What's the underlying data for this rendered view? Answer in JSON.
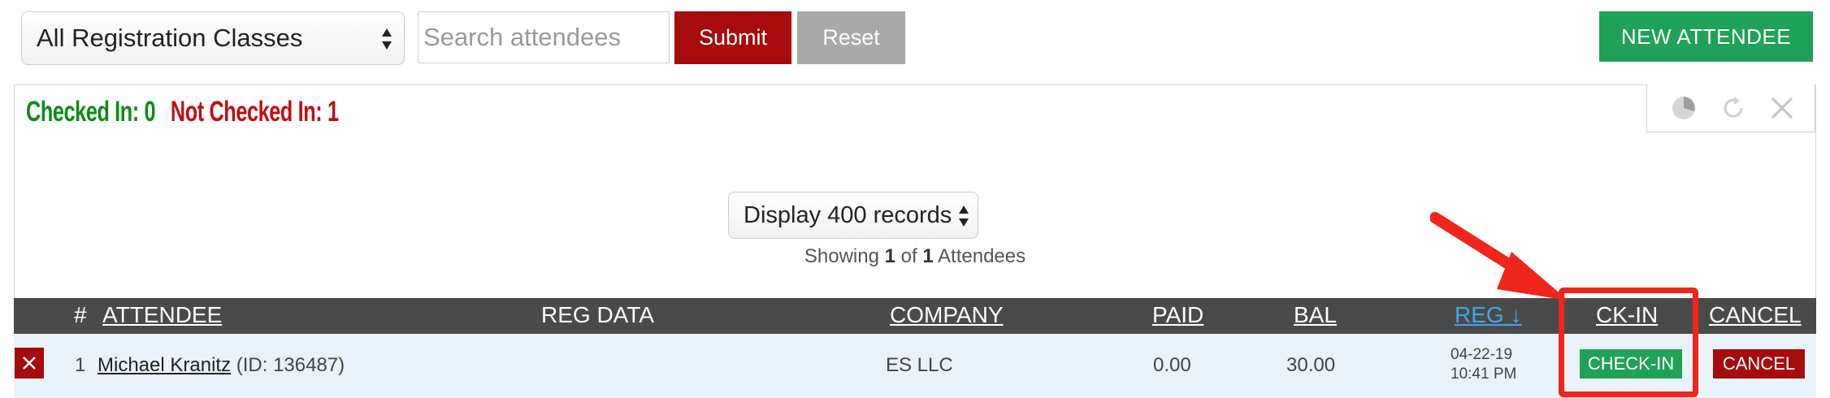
{
  "toolbar": {
    "class_select": "All Registration Classes",
    "search_placeholder": "Search attendees",
    "submit_label": "Submit",
    "reset_label": "Reset",
    "new_attendee_label": "NEW ATTENDEE"
  },
  "summary": {
    "checked_in": "Checked In: 0",
    "not_checked_in": "Not Checked In: 1"
  },
  "panel_tools": [
    "pie-chart-icon",
    "refresh-icon",
    "close-icon"
  ],
  "paging": {
    "display_select": "Display 400 records",
    "showing_prefix": "Showing",
    "showing_from": "1",
    "showing_of": "of",
    "showing_total": "1",
    "showing_suffix": "Attendees"
  },
  "table": {
    "headers": {
      "num": "#",
      "attendee": "ATTENDEE",
      "reg_data": "REG DATA",
      "company": "COMPANY",
      "paid": "PAID",
      "bal": "BAL",
      "reg": "REG ↓",
      "ck_in": "CK-IN",
      "cancel": "CANCEL"
    },
    "rows": [
      {
        "num": "1",
        "name": "Michael Kranitz",
        "id_text": "(ID: 136487)",
        "company": "ES LLC",
        "paid": "0.00",
        "bal": "30.00",
        "reg_date": "04-22-19",
        "reg_time": "10:41 PM",
        "checkin_label": "CHECK-IN",
        "cancel_label": "CANCEL"
      }
    ]
  },
  "colors": {
    "brand_red": "#a60c0e",
    "green": "#1fa257",
    "annotation_red": "#f0251b",
    "header_bg": "#4a4a4a",
    "sort_blue": "#3fa7e6"
  }
}
